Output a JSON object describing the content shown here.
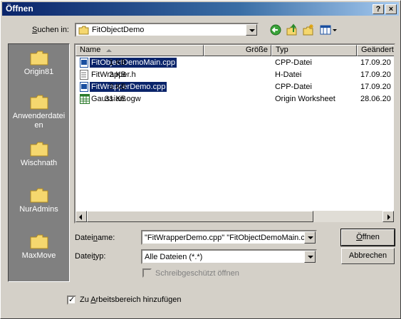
{
  "window": {
    "title": "Öffnen",
    "help_button": "?",
    "close_button": "×"
  },
  "lookin": {
    "label_pre": "",
    "label_ul": "S",
    "label_post": "uchen in:",
    "value": "FitObjectDemo"
  },
  "places": [
    {
      "label": "Origin81"
    },
    {
      "label": "Anwenderdatei en"
    },
    {
      "label": "Wischnath"
    },
    {
      "label": "NurAdmins"
    },
    {
      "label": "MaxMove"
    }
  ],
  "columns": {
    "name": "Name",
    "size": "Größe",
    "type": "Typ",
    "modified": "Geändert"
  },
  "files": [
    {
      "name": "FitObjectDemoMain.cpp",
      "size": "1 KB",
      "type": "CPP-Datei",
      "modified": "17.09.20",
      "selected": true,
      "icon": "cpp-file-icon"
    },
    {
      "name": "FitWrapper.h",
      "size": "2 KB",
      "type": "H-Datei",
      "modified": "17.09.20",
      "selected": false,
      "icon": "h-file-icon"
    },
    {
      "name": "FitWrapperDemo.cpp",
      "size": "3 KB",
      "type": "CPP-Datei",
      "modified": "17.09.20",
      "selected": true,
      "icon": "cpp-file-icon"
    },
    {
      "name": "Gaussian.ogw",
      "size": "31 KB",
      "type": "Origin Worksheet",
      "modified": "28.06.20",
      "selected": false,
      "icon": "worksheet-icon"
    }
  ],
  "filename": {
    "label_pre": "Datei",
    "label_ul": "n",
    "label_post": "ame:",
    "value": "\"FitWrapperDemo.cpp\" \"FitObjectDemoMain.c"
  },
  "filetype": {
    "label_pre": "Datei",
    "label_ul": "t",
    "label_post": "yp:",
    "value": "Alle Dateien (*.*)"
  },
  "readonly": {
    "label": "Schreibgeschützt öffnen"
  },
  "workspace": {
    "label_pre": "Zu ",
    "label_ul": "A",
    "label_post": "rbeitsbereich hinzufügen",
    "checked": true
  },
  "buttons": {
    "open_ul": "Ö",
    "open_post": "ffnen",
    "cancel": "Abbrechen"
  },
  "colors": {
    "selection": "#0a246a",
    "places_bg": "#808080",
    "face": "#d4d0c8"
  }
}
